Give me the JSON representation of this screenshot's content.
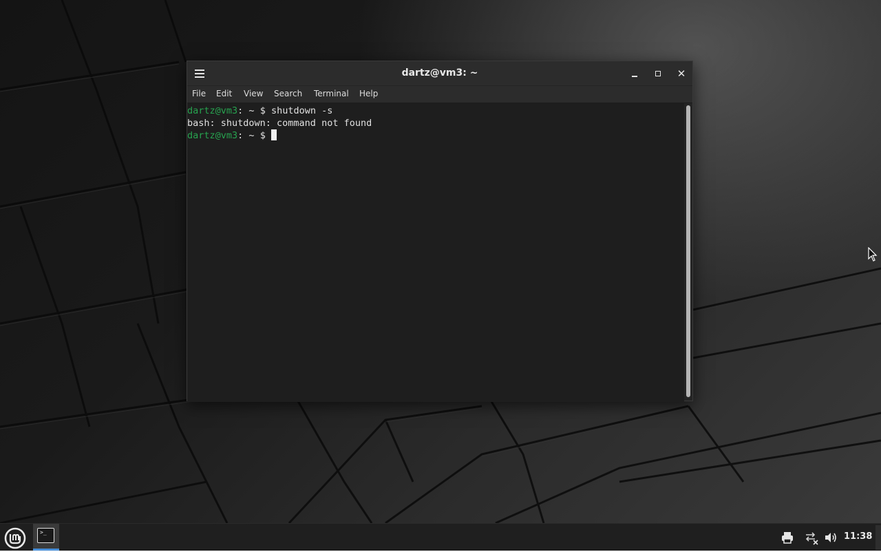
{
  "window": {
    "title": "dartz@vm3: ~",
    "menu": [
      "File",
      "Edit",
      "View",
      "Search",
      "Terminal",
      "Help"
    ]
  },
  "terminal": {
    "lines": [
      {
        "user_host": "dartz@vm3",
        "path": ": ~",
        "symbol": "$ ",
        "command": "shutdown -s"
      },
      {
        "output": "bash: shutdown: command not found"
      },
      {
        "user_host": "dartz@vm3",
        "path": ": ~",
        "symbol": "$ ",
        "command": ""
      }
    ]
  },
  "taskbar": {
    "clock": "11:38",
    "menu_icon": "linux-mint-logo-icon",
    "running_apps": [
      {
        "icon": "terminal-icon",
        "icon_glyph": ">_",
        "active": true
      }
    ],
    "tray_icons": [
      "printer-icon",
      "network-disconnected-icon",
      "volume-icon"
    ]
  },
  "colors": {
    "prompt_user": "#27a34f",
    "terminal_bg": "#1e1e1e",
    "titlebar_bg": "#2c2c2c",
    "taskbar_bg": "#1f1f1f",
    "active_indicator": "#4a90d9"
  }
}
